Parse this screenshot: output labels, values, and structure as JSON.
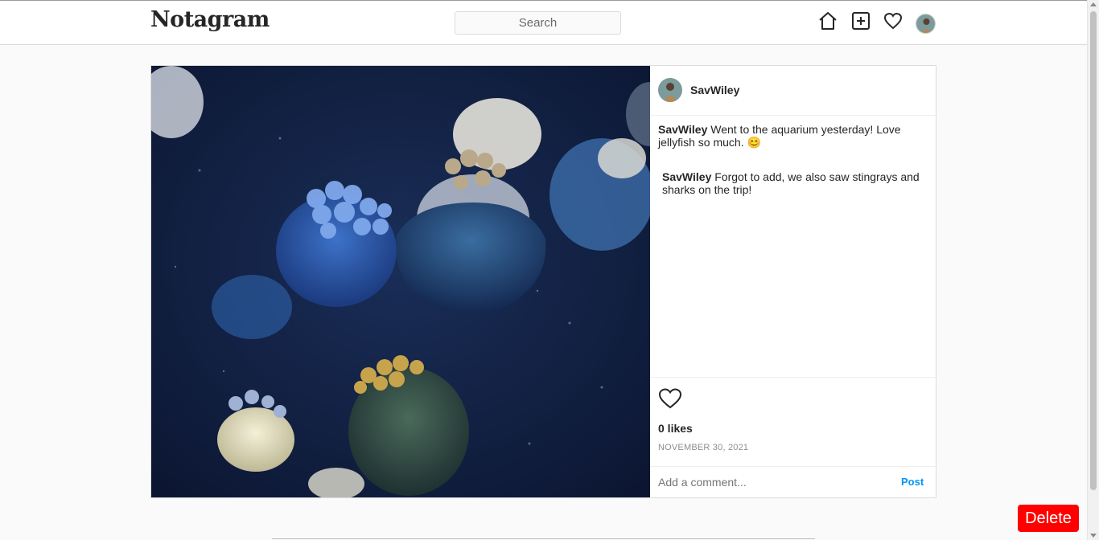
{
  "header": {
    "logo": "Notagram",
    "search_placeholder": "Search",
    "icons": [
      "home-icon",
      "new-post-icon",
      "heart-icon",
      "profile-avatar"
    ]
  },
  "post": {
    "image_alt": "jellyfish",
    "username": "SavWiley",
    "caption_user": "SavWiley",
    "caption_text": " Went to the aquarium yesterday! Love jellyfish so much. 😊",
    "comments": [
      {
        "user": "SavWiley",
        "text": " Forgot to add, we also saw stingrays and sharks on the trip!"
      }
    ],
    "likes_label": "0 likes",
    "date": "NOVEMBER 30, 2021",
    "comment_placeholder": "Add a comment...",
    "post_button": "Post"
  },
  "delete_button": "Delete",
  "colors": {
    "accent_blue": "#0095f6",
    "delete_red": "#ff0000",
    "border": "#dbdbdb",
    "background": "#fafafa"
  }
}
